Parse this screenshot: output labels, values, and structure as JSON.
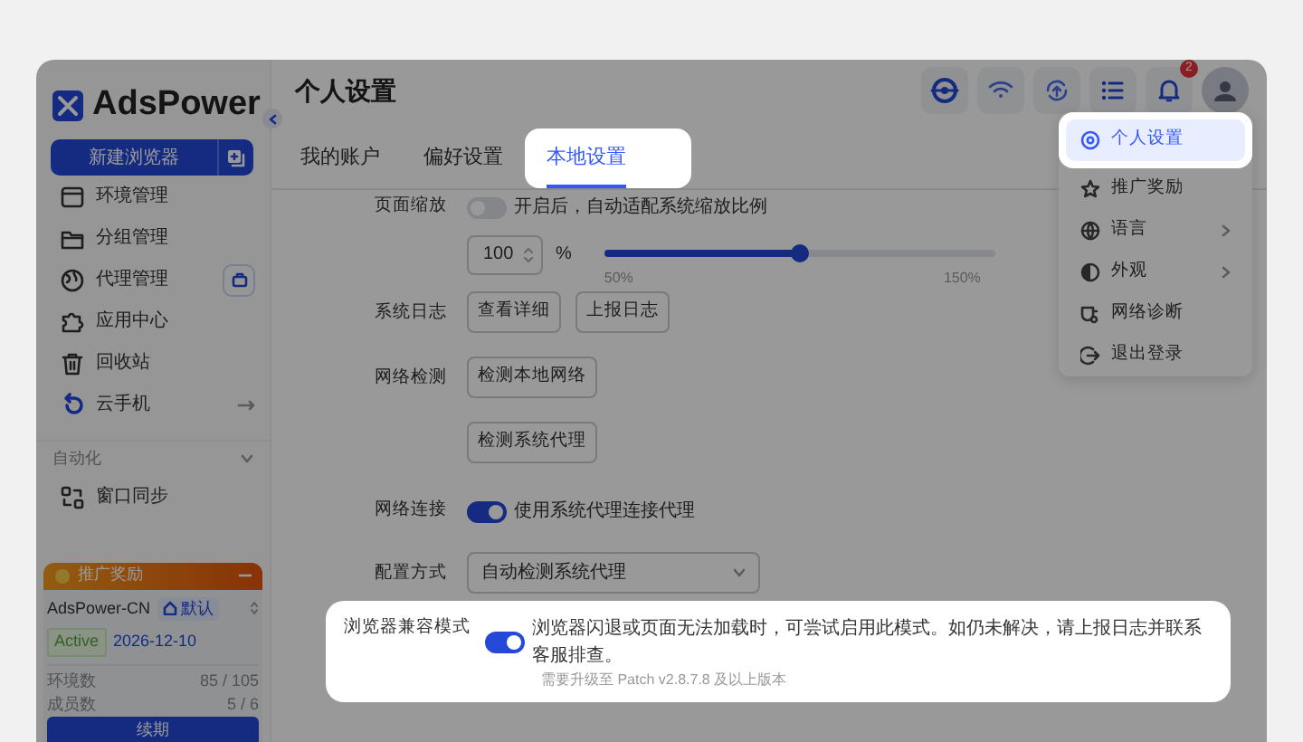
{
  "sidebar": {
    "logo": "AdsPower",
    "new_browser_button": "新建浏览器",
    "nav_items": [
      {
        "label": "环境管理",
        "kind": "plain"
      },
      {
        "label": "分组管理",
        "kind": "plain"
      },
      {
        "label": "代理管理",
        "kind": "tool"
      },
      {
        "label": "应用中心",
        "kind": "plain"
      },
      {
        "label": "回收站",
        "kind": "plain"
      },
      {
        "label": "云手机",
        "kind": "link"
      }
    ],
    "section": {
      "title": "自动化",
      "items": [
        {
          "label": "窗口同步"
        }
      ]
    },
    "promo": {
      "title": "推广奖励"
    },
    "team": {
      "name": "AdsPower-CN",
      "tag": "默认",
      "status": "Active",
      "expires": "2026-12-10",
      "stats": [
        {
          "label": "环境数",
          "value": "85 / 105"
        },
        {
          "label": "成员数",
          "value": "5 / 6"
        }
      ],
      "renew_button": "续期"
    }
  },
  "header": {
    "title": "个人设置",
    "notification_count": "2"
  },
  "tabs": [
    {
      "label": "我的账户",
      "selected": false,
      "spotlight": false
    },
    {
      "label": "偏好设置",
      "selected": false,
      "spotlight": false
    },
    {
      "label": "本地设置",
      "selected": true,
      "spotlight": true
    }
  ],
  "settings": [
    {
      "kind": "toggle",
      "label": "页面缩放",
      "on": false,
      "text": "开启后，自动适配系统缩放比例",
      "spotlight": false
    },
    {
      "kind": "zoom",
      "value": "100",
      "unit": "%",
      "level": 0.5,
      "min_label": "50%",
      "max_label": "150%",
      "spotlight": false
    },
    {
      "kind": "buttons",
      "label": "系统日志",
      "buttons": [
        "查看详细",
        "上报日志"
      ],
      "spotlight": false
    },
    {
      "kind": "buttons",
      "label": "网络检测",
      "buttons": [
        "检测本地网络"
      ],
      "spotlight": false
    },
    {
      "kind": "buttons",
      "buttons": [
        "检测系统代理"
      ],
      "spotlight": false
    },
    {
      "kind": "toggle",
      "label": "网络连接",
      "on": true,
      "text": "使用系统代理连接代理",
      "spotlight": false
    },
    {
      "kind": "select",
      "label": "配置方式",
      "value": "自动检测系统代理",
      "spotlight": false
    },
    {
      "kind": "toggle",
      "label": "浏览器兼容模式",
      "on": true,
      "text": "浏览器闪退或页面无法加载时，可尝试启用此模式。如仍未解决，请上报日志并联系客服排查。",
      "note": "需要升级至 Patch v2.8.7.8 及以上版本",
      "spotlight": true
    }
  ],
  "user_menu": [
    {
      "label": "个人设置",
      "selected": true,
      "spotlight": true,
      "submenu": false
    },
    {
      "label": "推广奖励",
      "selected": false,
      "spotlight": false,
      "submenu": false
    },
    {
      "label": "语言",
      "selected": false,
      "spotlight": false,
      "submenu": true
    },
    {
      "label": "外观",
      "selected": false,
      "spotlight": false,
      "submenu": true
    },
    {
      "label": "网络诊断",
      "selected": false,
      "spotlight": false,
      "submenu": false
    },
    {
      "label": "退出登录",
      "selected": false,
      "spotlight": false,
      "submenu": false
    }
  ]
}
